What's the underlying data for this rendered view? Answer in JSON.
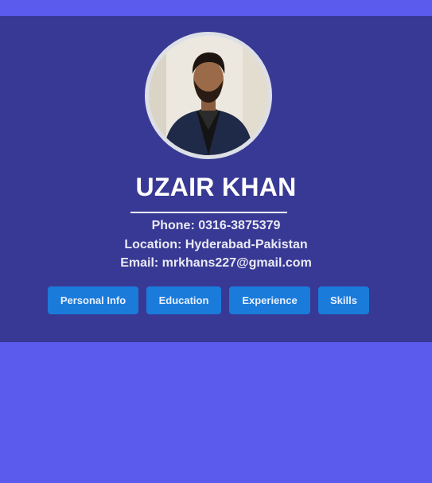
{
  "profile": {
    "name": "UZAIR KHAN",
    "phone": "Phone: 0316-3875379",
    "location": "Location: Hyderabad-Pakistan",
    "email": "Email: mrkhans227@gmail.com"
  },
  "nav": {
    "personal_info": "Personal Info",
    "education": "Education",
    "experience": "Experience",
    "skills": "Skills"
  },
  "colors": {
    "page_background": "#5b5cee",
    "card_background": "#383994",
    "button": "#1a7bdb",
    "text": "#ffffff"
  }
}
